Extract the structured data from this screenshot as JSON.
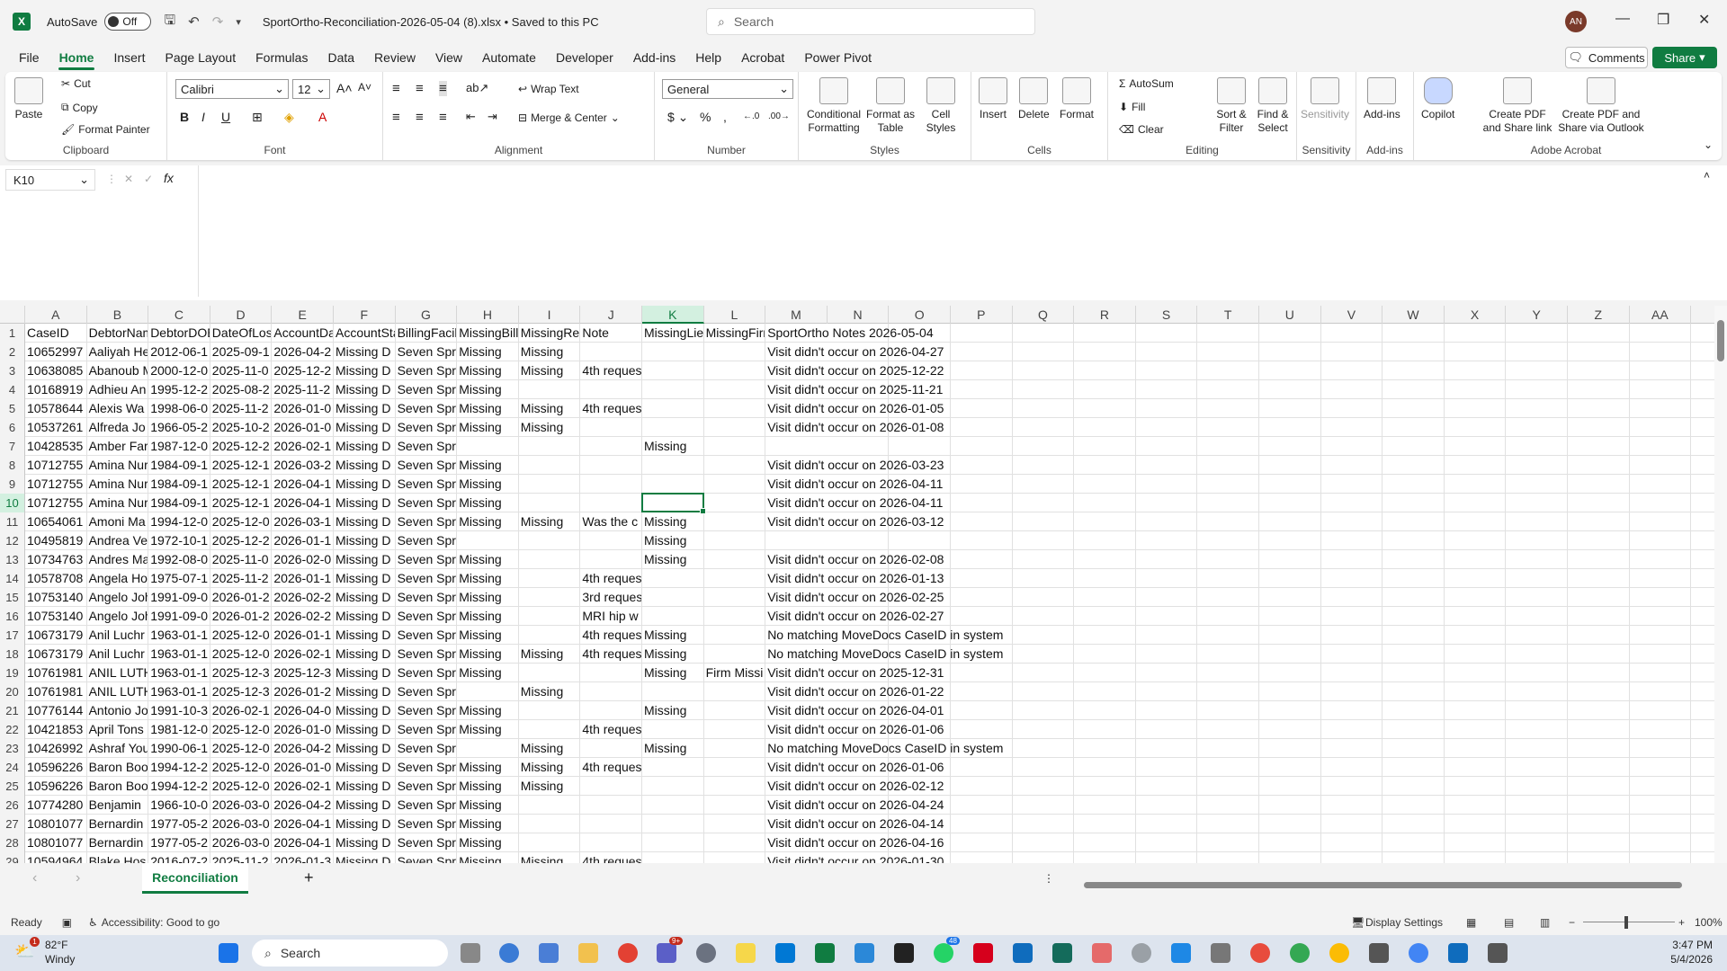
{
  "titlebar": {
    "autosave_label": "AutoSave",
    "autosave_state": "Off",
    "file_title": "SportOrtho-Reconciliation-2026-05-04 (8).xlsx • Saved to this PC",
    "search_placeholder": "Search",
    "avatar_initials": "AN"
  },
  "menu": [
    "File",
    "Home",
    "Insert",
    "Page Layout",
    "Formulas",
    "Data",
    "Review",
    "View",
    "Automate",
    "Developer",
    "Add-ins",
    "Help",
    "Acrobat",
    "Power Pivot"
  ],
  "comments_label": "Comments",
  "share_label": "Share",
  "ribbon": {
    "clipboard": {
      "paste": "Paste",
      "cut": "Cut",
      "copy": "Copy",
      "format_painter": "Format Painter",
      "label": "Clipboard"
    },
    "font": {
      "name": "Calibri",
      "size": "12",
      "label": "Font"
    },
    "alignment": {
      "wrap": "Wrap Text",
      "merge": "Merge & Center",
      "label": "Alignment"
    },
    "number": {
      "format": "General",
      "label": "Number"
    },
    "styles": {
      "conditional": "Conditional Formatting",
      "format_table": "Format as Table",
      "cell_styles": "Cell Styles",
      "label": "Styles"
    },
    "cells": {
      "insert": "Insert",
      "delete": "Delete",
      "format": "Format",
      "label": "Cells"
    },
    "editing": {
      "autosum": "AutoSum",
      "fill": "Fill",
      "clear": "Clear",
      "sort": "Sort & Filter",
      "find": "Find & Select",
      "label": "Editing"
    },
    "sensitivity": {
      "btn": "Sensitivity",
      "label": "Sensitivity"
    },
    "addins": {
      "btn": "Add-ins",
      "label": "Add-ins"
    },
    "copilot": "Copilot",
    "acrobat": {
      "create_share": "Create PDF and Share link",
      "create_outlook": "Create PDF and Share via Outlook",
      "label": "Adobe Acrobat"
    }
  },
  "namebox": "K10",
  "columns": [
    "A",
    "B",
    "C",
    "D",
    "E",
    "F",
    "G",
    "H",
    "I",
    "J",
    "K",
    "L",
    "M",
    "N",
    "O",
    "P",
    "Q",
    "R",
    "S",
    "T",
    "U",
    "V",
    "W",
    "X",
    "Y",
    "Z",
    "AA"
  ],
  "selected_column": "K",
  "selected_row": 10,
  "rows": [
    {
      "n": "1",
      "c": [
        "CaseID",
        "DebtorName",
        "DebtorDOB",
        "DateOfLoss",
        "AccountDate",
        "AccountStatus",
        "BillingFacility",
        "MissingBill",
        "MissingRecord",
        "Note",
        "MissingLien",
        "MissingFirm",
        "SportOrtho Notes 2026-05-04"
      ]
    },
    {
      "n": "2",
      "c": [
        "10652997",
        "Aaliyah He",
        "2012-06-1",
        "2025-09-1",
        "2026-04-2",
        "Missing D",
        "Seven Spri",
        "Missing",
        "Missing",
        "",
        "",
        "",
        "Visit didn't occur on 2026-04-27"
      ]
    },
    {
      "n": "3",
      "c": [
        "10638085",
        "Abanoub M",
        "2000-12-0",
        "2025-11-0",
        "2025-12-2",
        "Missing D",
        "Seven Spri",
        "Missing",
        "Missing",
        "4th reques",
        "",
        "",
        "Visit didn't occur on 2025-12-22"
      ]
    },
    {
      "n": "4",
      "c": [
        "10168919",
        "Adhieu An",
        "1995-12-2",
        "2025-08-2",
        "2025-11-2",
        "Missing D",
        "Seven Spri",
        "Missing",
        "",
        "",
        "",
        "",
        "Visit didn't occur on 2025-11-21"
      ]
    },
    {
      "n": "5",
      "c": [
        "10578644",
        "Alexis Wa",
        "1998-06-0",
        "2025-11-2",
        "2026-01-0",
        "Missing D",
        "Seven Spri",
        "Missing",
        "Missing",
        "4th reques",
        "",
        "",
        "Visit didn't occur on 2026-01-05"
      ]
    },
    {
      "n": "6",
      "c": [
        "10537261",
        "Alfreda Jo",
        "1966-05-2",
        "2025-10-2",
        "2026-01-0",
        "Missing D",
        "Seven Spri",
        "Missing",
        "Missing",
        "",
        "",
        "",
        "Visit didn't occur on 2026-01-08"
      ]
    },
    {
      "n": "7",
      "c": [
        "10428535",
        "Amber Far",
        "1987-12-0",
        "2025-12-2",
        "2026-02-1",
        "Missing D",
        "Seven Spri",
        "",
        "",
        "",
        "Missing",
        "",
        ""
      ]
    },
    {
      "n": "8",
      "c": [
        "10712755",
        "Amina Nur",
        "1984-09-1",
        "2025-12-1",
        "2026-03-2",
        "Missing D",
        "Seven Spri",
        "Missing",
        "",
        "",
        "",
        "",
        "Visit didn't occur on 2026-03-23"
      ]
    },
    {
      "n": "9",
      "c": [
        "10712755",
        "Amina Nur",
        "1984-09-1",
        "2025-12-1",
        "2026-04-1",
        "Missing D",
        "Seven Spri",
        "Missing",
        "",
        "",
        "",
        "",
        "Visit didn't occur on 2026-04-11"
      ]
    },
    {
      "n": "10",
      "c": [
        "10712755",
        "Amina Nur",
        "1984-09-1",
        "2025-12-1",
        "2026-04-1",
        "Missing D",
        "Seven Spri",
        "Missing",
        "",
        "",
        "",
        "",
        "Visit didn't occur on 2026-04-11"
      ]
    },
    {
      "n": "11",
      "c": [
        "10654061",
        "Amoni Ma",
        "1994-12-0",
        "2025-12-0",
        "2026-03-1",
        "Missing D",
        "Seven Spri",
        "Missing",
        "Missing",
        "Was the c",
        "Missing",
        "",
        "Visit didn't occur on 2026-03-12"
      ]
    },
    {
      "n": "12",
      "c": [
        "10495819",
        "Andrea Ve",
        "1972-10-1",
        "2025-12-2",
        "2026-01-1",
        "Missing D",
        "Seven Spri",
        "",
        "",
        "",
        "Missing",
        "",
        ""
      ]
    },
    {
      "n": "13",
      "c": [
        "10734763",
        "Andres Ma",
        "1992-08-0",
        "2025-11-0",
        "2026-02-0",
        "Missing D",
        "Seven Spri",
        "Missing",
        "",
        "",
        "Missing",
        "",
        "Visit didn't occur on 2026-02-08"
      ]
    },
    {
      "n": "14",
      "c": [
        "10578708",
        "Angela Ho",
        "1975-07-1",
        "2025-11-2",
        "2026-01-1",
        "Missing D",
        "Seven Spri",
        "Missing",
        "",
        "4th reques",
        "",
        "",
        "Visit didn't occur on 2026-01-13"
      ]
    },
    {
      "n": "15",
      "c": [
        "10753140",
        "Angelo Joh",
        "1991-09-0",
        "2026-01-2",
        "2026-02-2",
        "Missing D",
        "Seven Spri",
        "Missing",
        "",
        "3rd reques",
        "",
        "",
        "Visit didn't occur on 2026-02-25"
      ]
    },
    {
      "n": "16",
      "c": [
        "10753140",
        "Angelo Joh",
        "1991-09-0",
        "2026-01-2",
        "2026-02-2",
        "Missing D",
        "Seven Spri",
        "Missing",
        "",
        "MRI hip w",
        "",
        "",
        "Visit didn't occur on 2026-02-27"
      ]
    },
    {
      "n": "17",
      "c": [
        "10673179",
        "Anil Luchr",
        "1963-01-1",
        "2025-12-0",
        "2026-01-1",
        "Missing D",
        "Seven Spri",
        "Missing",
        "",
        "4th reques",
        "Missing",
        "",
        "No matching MoveDocs CaseID in system"
      ]
    },
    {
      "n": "18",
      "c": [
        "10673179",
        "Anil Luchr",
        "1963-01-1",
        "2025-12-0",
        "2026-02-1",
        "Missing D",
        "Seven Spri",
        "Missing",
        "Missing",
        "4th reques",
        "Missing",
        "",
        "No matching MoveDocs CaseID in system"
      ]
    },
    {
      "n": "19",
      "c": [
        "10761981",
        "ANIL LUTH",
        "1963-01-1",
        "2025-12-3",
        "2025-12-3",
        "Missing D",
        "Seven Spri",
        "Missing",
        "",
        "",
        "Missing",
        "Firm Missi",
        "Visit didn't occur on 2025-12-31"
      ]
    },
    {
      "n": "20",
      "c": [
        "10761981",
        "ANIL LUTH",
        "1963-01-1",
        "2025-12-3",
        "2026-01-2",
        "Missing D",
        "Seven Spri",
        "",
        "Missing",
        "",
        "",
        "",
        "Visit didn't occur on 2026-01-22"
      ]
    },
    {
      "n": "21",
      "c": [
        "10776144",
        "Antonio Jo",
        "1991-10-3",
        "2026-02-1",
        "2026-04-0",
        "Missing D",
        "Seven Spri",
        "Missing",
        "",
        "",
        "Missing",
        "",
        "Visit didn't occur on 2026-04-01"
      ]
    },
    {
      "n": "22",
      "c": [
        "10421853",
        "April Tons",
        "1981-12-0",
        "2025-12-0",
        "2026-01-0",
        "Missing D",
        "Seven Spri",
        "Missing",
        "",
        "4th reques",
        "",
        "",
        "Visit didn't occur on 2026-01-06"
      ]
    },
    {
      "n": "23",
      "c": [
        "10426992",
        "Ashraf You",
        "1990-06-1",
        "2025-12-0",
        "2026-04-2",
        "Missing D",
        "Seven Spri",
        "",
        "Missing",
        "",
        "Missing",
        "",
        "No matching MoveDocs CaseID in system"
      ]
    },
    {
      "n": "24",
      "c": [
        "10596226",
        "Baron Boo",
        "1994-12-2",
        "2025-12-0",
        "2026-01-0",
        "Missing D",
        "Seven Spri",
        "Missing",
        "Missing",
        "4th reques",
        "",
        "",
        "Visit didn't occur on 2026-01-06"
      ]
    },
    {
      "n": "25",
      "c": [
        "10596226",
        "Baron Boo",
        "1994-12-2",
        "2025-12-0",
        "2026-02-1",
        "Missing D",
        "Seven Spri",
        "Missing",
        "Missing",
        "",
        "",
        "",
        "Visit didn't occur on 2026-02-12"
      ]
    },
    {
      "n": "26",
      "c": [
        "10774280",
        "Benjamin",
        "1966-10-0",
        "2026-03-0",
        "2026-04-2",
        "Missing D",
        "Seven Spri",
        "Missing",
        "",
        "",
        "",
        "",
        "Visit didn't occur on 2026-04-24"
      ]
    },
    {
      "n": "27",
      "c": [
        "10801077",
        "Bernardin",
        "1977-05-2",
        "2026-03-0",
        "2026-04-1",
        "Missing D",
        "Seven Spri",
        "Missing",
        "",
        "",
        "",
        "",
        "Visit didn't occur on 2026-04-14"
      ]
    },
    {
      "n": "28",
      "c": [
        "10801077",
        "Bernardin",
        "1977-05-2",
        "2026-03-0",
        "2026-04-1",
        "Missing D",
        "Seven Spri",
        "Missing",
        "",
        "",
        "",
        "",
        "Visit didn't occur on 2026-04-16"
      ]
    },
    {
      "n": "29",
      "c": [
        "10594964",
        "Blake Hos",
        "2016-07-2",
        "2025-11-2",
        "2026-01-3",
        "Missing D",
        "Seven Spri",
        "Missing",
        "Missing",
        "4th reques",
        "",
        "",
        "Visit didn't occur on 2026-01-30"
      ]
    }
  ],
  "sheet_tab": "Reconciliation",
  "status": {
    "ready": "Ready",
    "accessibility": "Accessibility: Good to go",
    "display_settings": "Display Settings",
    "zoom": "100%"
  },
  "taskbar": {
    "temp": "82°F",
    "weather": "Windy",
    "search": "Search",
    "time": "3:47 PM",
    "date": "5/4/2026",
    "badge1": "1",
    "badge_teams": "9+",
    "badge_whatsapp": "48"
  }
}
